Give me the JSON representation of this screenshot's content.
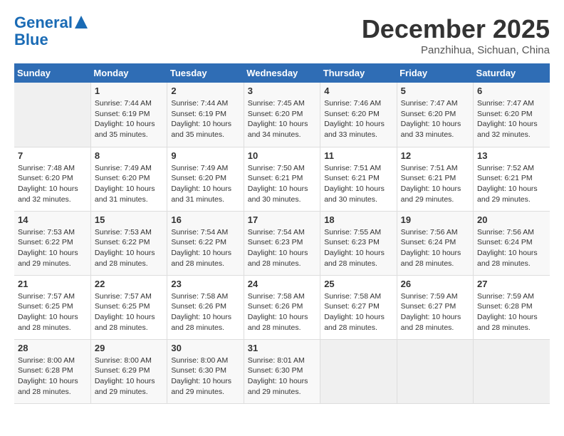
{
  "logo": {
    "line1": "General",
    "line2": "Blue"
  },
  "title": "December 2025",
  "location": "Panzhihua, Sichuan, China",
  "weekdays": [
    "Sunday",
    "Monday",
    "Tuesday",
    "Wednesday",
    "Thursday",
    "Friday",
    "Saturday"
  ],
  "weeks": [
    [
      {
        "day": "",
        "info": ""
      },
      {
        "day": "1",
        "info": "Sunrise: 7:44 AM\nSunset: 6:19 PM\nDaylight: 10 hours and 35 minutes."
      },
      {
        "day": "2",
        "info": "Sunrise: 7:44 AM\nSunset: 6:19 PM\nDaylight: 10 hours and 35 minutes."
      },
      {
        "day": "3",
        "info": "Sunrise: 7:45 AM\nSunset: 6:20 PM\nDaylight: 10 hours and 34 minutes."
      },
      {
        "day": "4",
        "info": "Sunrise: 7:46 AM\nSunset: 6:20 PM\nDaylight: 10 hours and 33 minutes."
      },
      {
        "day": "5",
        "info": "Sunrise: 7:47 AM\nSunset: 6:20 PM\nDaylight: 10 hours and 33 minutes."
      },
      {
        "day": "6",
        "info": "Sunrise: 7:47 AM\nSunset: 6:20 PM\nDaylight: 10 hours and 32 minutes."
      }
    ],
    [
      {
        "day": "7",
        "info": "Sunrise: 7:48 AM\nSunset: 6:20 PM\nDaylight: 10 hours and 32 minutes."
      },
      {
        "day": "8",
        "info": "Sunrise: 7:49 AM\nSunset: 6:20 PM\nDaylight: 10 hours and 31 minutes."
      },
      {
        "day": "9",
        "info": "Sunrise: 7:49 AM\nSunset: 6:20 PM\nDaylight: 10 hours and 31 minutes."
      },
      {
        "day": "10",
        "info": "Sunrise: 7:50 AM\nSunset: 6:21 PM\nDaylight: 10 hours and 30 minutes."
      },
      {
        "day": "11",
        "info": "Sunrise: 7:51 AM\nSunset: 6:21 PM\nDaylight: 10 hours and 30 minutes."
      },
      {
        "day": "12",
        "info": "Sunrise: 7:51 AM\nSunset: 6:21 PM\nDaylight: 10 hours and 29 minutes."
      },
      {
        "day": "13",
        "info": "Sunrise: 7:52 AM\nSunset: 6:21 PM\nDaylight: 10 hours and 29 minutes."
      }
    ],
    [
      {
        "day": "14",
        "info": "Sunrise: 7:53 AM\nSunset: 6:22 PM\nDaylight: 10 hours and 29 minutes."
      },
      {
        "day": "15",
        "info": "Sunrise: 7:53 AM\nSunset: 6:22 PM\nDaylight: 10 hours and 28 minutes."
      },
      {
        "day": "16",
        "info": "Sunrise: 7:54 AM\nSunset: 6:22 PM\nDaylight: 10 hours and 28 minutes."
      },
      {
        "day": "17",
        "info": "Sunrise: 7:54 AM\nSunset: 6:23 PM\nDaylight: 10 hours and 28 minutes."
      },
      {
        "day": "18",
        "info": "Sunrise: 7:55 AM\nSunset: 6:23 PM\nDaylight: 10 hours and 28 minutes."
      },
      {
        "day": "19",
        "info": "Sunrise: 7:56 AM\nSunset: 6:24 PM\nDaylight: 10 hours and 28 minutes."
      },
      {
        "day": "20",
        "info": "Sunrise: 7:56 AM\nSunset: 6:24 PM\nDaylight: 10 hours and 28 minutes."
      }
    ],
    [
      {
        "day": "21",
        "info": "Sunrise: 7:57 AM\nSunset: 6:25 PM\nDaylight: 10 hours and 28 minutes."
      },
      {
        "day": "22",
        "info": "Sunrise: 7:57 AM\nSunset: 6:25 PM\nDaylight: 10 hours and 28 minutes."
      },
      {
        "day": "23",
        "info": "Sunrise: 7:58 AM\nSunset: 6:26 PM\nDaylight: 10 hours and 28 minutes."
      },
      {
        "day": "24",
        "info": "Sunrise: 7:58 AM\nSunset: 6:26 PM\nDaylight: 10 hours and 28 minutes."
      },
      {
        "day": "25",
        "info": "Sunrise: 7:58 AM\nSunset: 6:27 PM\nDaylight: 10 hours and 28 minutes."
      },
      {
        "day": "26",
        "info": "Sunrise: 7:59 AM\nSunset: 6:27 PM\nDaylight: 10 hours and 28 minutes."
      },
      {
        "day": "27",
        "info": "Sunrise: 7:59 AM\nSunset: 6:28 PM\nDaylight: 10 hours and 28 minutes."
      }
    ],
    [
      {
        "day": "28",
        "info": "Sunrise: 8:00 AM\nSunset: 6:28 PM\nDaylight: 10 hours and 28 minutes."
      },
      {
        "day": "29",
        "info": "Sunrise: 8:00 AM\nSunset: 6:29 PM\nDaylight: 10 hours and 29 minutes."
      },
      {
        "day": "30",
        "info": "Sunrise: 8:00 AM\nSunset: 6:30 PM\nDaylight: 10 hours and 29 minutes."
      },
      {
        "day": "31",
        "info": "Sunrise: 8:01 AM\nSunset: 6:30 PM\nDaylight: 10 hours and 29 minutes."
      },
      {
        "day": "",
        "info": ""
      },
      {
        "day": "",
        "info": ""
      },
      {
        "day": "",
        "info": ""
      }
    ]
  ]
}
